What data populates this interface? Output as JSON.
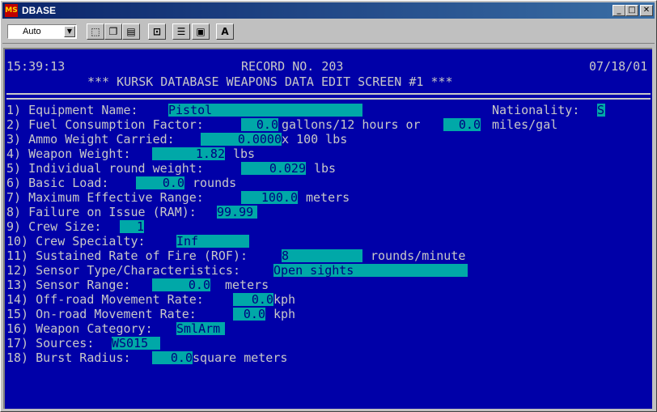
{
  "window": {
    "title": "DBASE",
    "app_icon": "MS",
    "controls": {
      "minimize": "_",
      "maximize": "□",
      "close": "✕"
    }
  },
  "toolbar": {
    "font_size_value": "Auto",
    "buttons": [
      "select-icon",
      "copy-icon",
      "paste-icon",
      "fullscreen-icon",
      "properties-icon",
      "background-icon",
      "font-icon"
    ],
    "font_button_label": "A"
  },
  "header": {
    "time": "15:39:13",
    "record": "RECORD NO. 203",
    "date": "07/18/01",
    "subtitle": "*** KURSK DATABASE WEAPONS DATA EDIT SCREEN #1 ***"
  },
  "nationality": {
    "label": "Nationality:",
    "value": "S"
  },
  "fields": [
    {
      "label": "1) Equipment Name:",
      "value": "Pistol"
    },
    {
      "label": "2) Fuel Consumption Factor:",
      "value": "0.0",
      "unit": "gallons/12 hours or",
      "value2": "0.0",
      "unit2": "miles/gal"
    },
    {
      "label": "3) Ammo Weight Carried:",
      "value": "0.0000",
      "unit": "x 100 lbs"
    },
    {
      "label": "4) Weapon Weight:",
      "value": "1.82",
      "unit": "lbs"
    },
    {
      "label": "5) Individual round weight:",
      "value": "0.029",
      "unit": "lbs"
    },
    {
      "label": "6) Basic Load:",
      "value": "0.0",
      "unit": "rounds"
    },
    {
      "label": "7) Maximum Effective Range:",
      "value": "100.0",
      "unit": "meters"
    },
    {
      "label": "8) Failure on Issue (RAM):",
      "value": "99.99"
    },
    {
      "label": "9) Crew Size:",
      "value": "1"
    },
    {
      "label": "10) Crew Specialty:",
      "value": "Inf"
    },
    {
      "label": "11) Sustained Rate of Fire (ROF):",
      "value": "8",
      "unit": "rounds/minute"
    },
    {
      "label": "12) Sensor Type/Characteristics:",
      "value": "Open sights"
    },
    {
      "label": "13) Sensor Range:",
      "value": "0.0",
      "unit": "meters"
    },
    {
      "label": "14) Off-road Movement Rate:",
      "value": "0.0",
      "unit": "kph"
    },
    {
      "label": "15) On-road Movement Rate:",
      "value": "0.0",
      "unit": "kph"
    },
    {
      "label": "16) Weapon Category:",
      "value": "SmlArm"
    },
    {
      "label": "17) Sources:",
      "value": "WS015"
    },
    {
      "label": "18) Burst Radius:",
      "value": "0.0",
      "unit": "square meters"
    }
  ]
}
